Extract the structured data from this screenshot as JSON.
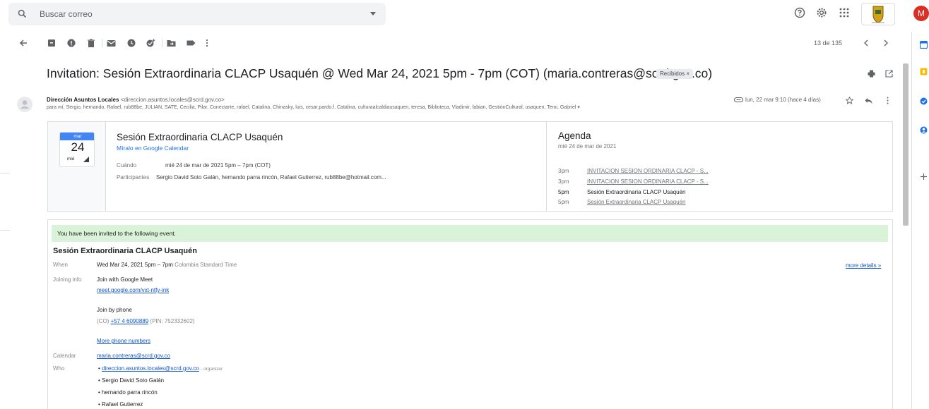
{
  "search": {
    "placeholder": "Buscar correo"
  },
  "header_icons": [
    "help-icon",
    "settings-icon",
    "apps-icon",
    "bogota-shield-logo"
  ],
  "account": {
    "avatar_letter": "M",
    "avatar_color": "#d93025"
  },
  "toolbar": {
    "icons": [
      "back-arrow-icon",
      "archive-icon",
      "report-spam-icon",
      "delete-icon",
      "mark-unread-icon",
      "snooze-icon",
      "add-task-icon",
      "move-to-icon",
      "label-icon",
      "more-icon"
    ],
    "pager_text": "13 de 135"
  },
  "message": {
    "subject": "Invitation: Sesión Extraordinaria CLACP Usaquén @ Wed Mar 24, 2021 5pm - 7pm (COT) (maria.contreras@scrd.gov.co)",
    "label_chip": "Recibidos ×",
    "sender_name": "Dirección Asuntos Locales",
    "sender_email": "<direccion.asuntos.locales@scrd.gov.co>",
    "recipients": "para mí, Sergio, hernando, Rafael, rub88be, JULIAN, SATE, Cecilia, Pilar, Conectarte, rafael, Catalina, Chinasky, luis, cesar.pardo.f, Catalina, culturaalcaldiausaquen, teresa, Biblioteca, Vladimir, fabian, GestiónCultural, usaquen, Temi, Gabriel ▾",
    "date": "lun, 22 mar 9:10 (hace 4 días)"
  },
  "invite_card": {
    "cal_month": "mar",
    "cal_day": "24",
    "cal_dow": "mié",
    "title": "Sesión Extraordinaria CLACP Usaquén",
    "calendar_link": "Míralo en Google Calendar",
    "when_label": "Cuándo",
    "when_value": "mié 24 de mar de 2021 5pm – 7pm (COT)",
    "participants_label": "Participantes",
    "participants_value": "Sergio David Soto Galán, hernando parra rincón, Rafael Gutierrez, rub88be@hotmail.com..."
  },
  "agenda": {
    "title": "Agenda",
    "date": "mié 24 de mar de 2021",
    "items": [
      {
        "time": "3pm",
        "label": "INVITACION SESION ORDINARIA CLACP - S..."
      },
      {
        "time": "3pm",
        "label": "INVITACION SESION ORDINARIA CLACP - S..."
      },
      {
        "time": "5pm",
        "label": "Sesión Extraordinaria CLACP Usaquén"
      },
      {
        "time": "5pm",
        "label": "Sesión Extraordinaria CLACP Usaquén"
      }
    ]
  },
  "body": {
    "banner": "You have been invited to the following event.",
    "title": "Sesión Extraordinaria CLACP Usaquén",
    "when_label": "When",
    "when_value": "Wed Mar 24, 2021 5pm – 7pm",
    "when_tz": "Colombia Standard Time",
    "more_details": "more details »",
    "joining_label": "Joining info",
    "join_meet": "Join with Google Meet",
    "meet_link": "meet.google.com/vxt-ntfy-ink",
    "join_phone": "Join by phone",
    "phone_prefix": "(CO)",
    "phone_number": "+57 4 6090889",
    "phone_pin": "(PIN: 752332602)",
    "more_phones": "More phone numbers",
    "calendar_label": "Calendar",
    "calendar_value": "maria.contreras@scrd.gov.co",
    "who_label": "Who",
    "who": [
      {
        "name": "direccion.asuntos.locales@scrd.gov.co",
        "note": "- organizer"
      },
      {
        "name": "Sergio David Soto Galán",
        "note": ""
      },
      {
        "name": "hernando parra rincón",
        "note": ""
      },
      {
        "name": "Rafael Gutierrez",
        "note": ""
      }
    ]
  }
}
